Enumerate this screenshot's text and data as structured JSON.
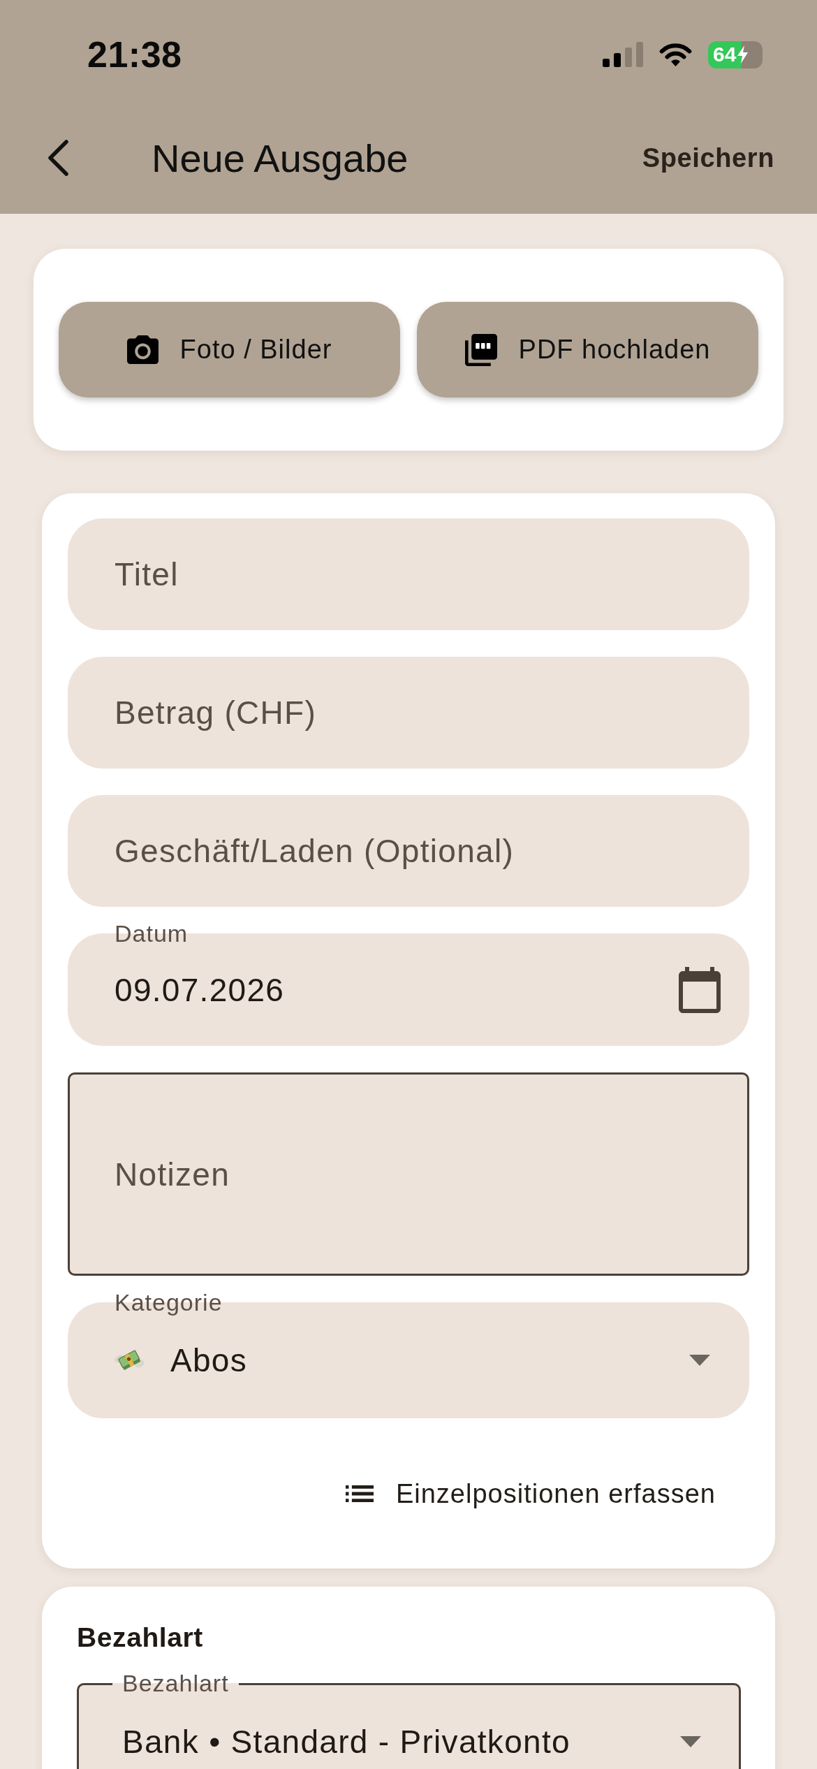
{
  "status_bar": {
    "time": "21:38",
    "battery": "64"
  },
  "app_bar": {
    "title": "Neue Ausgabe",
    "action": "Speichern"
  },
  "upload_buttons": [
    {
      "kind": "camera",
      "label": "Foto / Bilder"
    },
    {
      "kind": "pdf",
      "label": "PDF hochladen"
    }
  ],
  "form": {
    "fields": [
      {
        "kind": "text",
        "placeholder": "Titel"
      },
      {
        "kind": "text",
        "placeholder": "Betrag (CHF)"
      },
      {
        "kind": "text",
        "placeholder": "Geschäft/Laden (Optional)"
      },
      {
        "kind": "date",
        "label": "Datum",
        "value": "09.07.2026"
      },
      {
        "kind": "notes",
        "placeholder": "Notizen"
      },
      {
        "kind": "select",
        "label": "Kategorie",
        "value": "Abos"
      }
    ],
    "items_button": "Einzelpositionen erfassen"
  },
  "payment": {
    "heading": "Bezahlart",
    "field": {
      "label": "Bezahlart",
      "value": "Bank • Standard - Privatkonto"
    }
  }
}
